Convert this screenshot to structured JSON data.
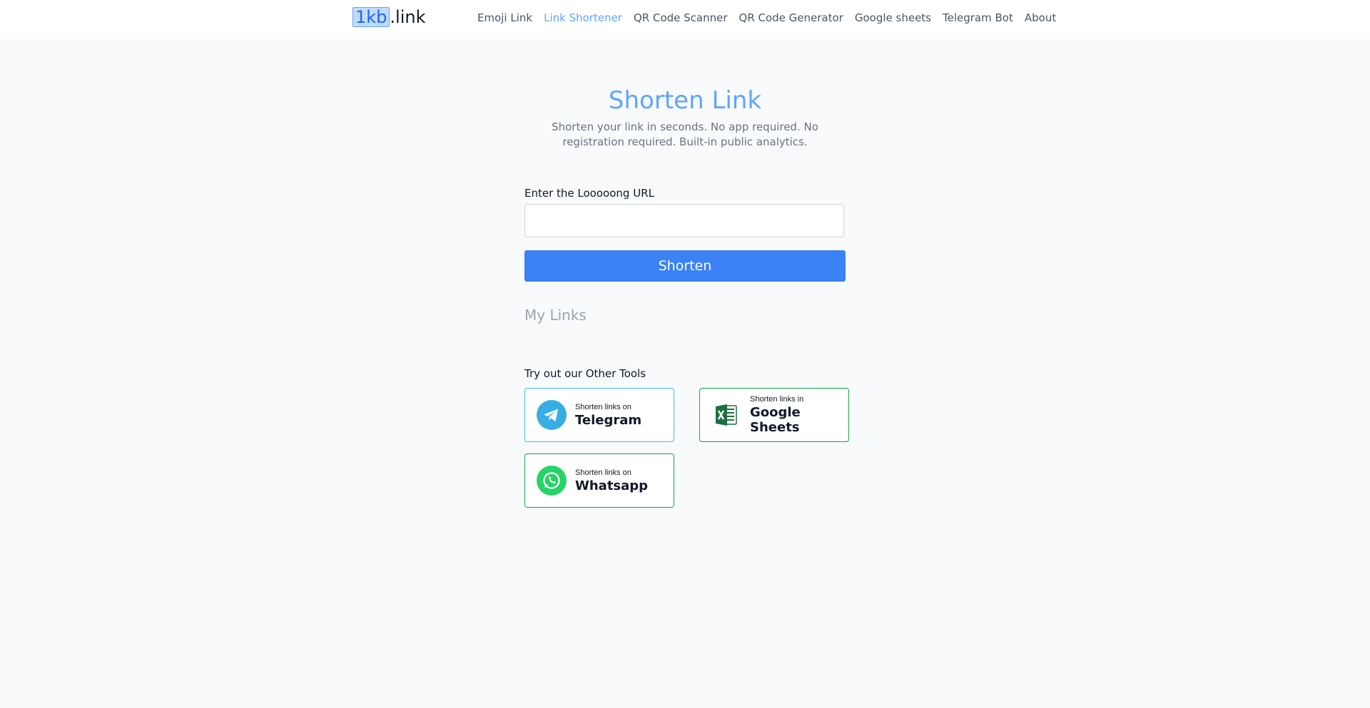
{
  "header": {
    "logo_prefix": "1kb",
    "logo_suffix": ".link",
    "nav": [
      {
        "label": "Emoji Link",
        "active": false
      },
      {
        "label": "Link Shortener",
        "active": true
      },
      {
        "label": "QR Code Scanner",
        "active": false
      },
      {
        "label": "QR Code Generator",
        "active": false
      },
      {
        "label": "Google sheets",
        "active": false
      },
      {
        "label": "Telegram Bot",
        "active": false
      },
      {
        "label": "About",
        "active": false
      }
    ]
  },
  "main": {
    "title": "Shorten Link",
    "subtitle": "Shorten your link in seconds. No app required. No registration required. Built-in public analytics.",
    "url_label": "Enter the Looooong URL",
    "url_value": "",
    "button_label": "Shorten",
    "my_links_heading": "My Links",
    "tools_heading": "Try out our Other Tools",
    "tools": [
      {
        "small": "Shorten links on",
        "big": "Telegram",
        "icon": "telegram-icon"
      },
      {
        "small": "Shorten links in",
        "big": "Google Sheets",
        "icon": "excel-icon"
      },
      {
        "small": "Shorten links on",
        "big": "Whatsapp",
        "icon": "whatsapp-icon"
      }
    ]
  },
  "colors": {
    "accent": "#3b82f6",
    "title": "#60a5fa",
    "telegram": "#37aee2",
    "sheets": "#1d6f42",
    "whatsapp": "#25d366"
  }
}
